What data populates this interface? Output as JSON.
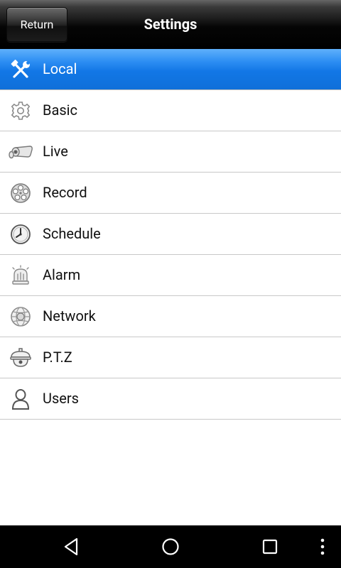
{
  "header": {
    "title": "Settings",
    "return_label": "Return"
  },
  "menu": {
    "selected_index": 0,
    "items": [
      {
        "label": "Local",
        "icon": "tools-icon"
      },
      {
        "label": "Basic",
        "icon": "gear-icon"
      },
      {
        "label": "Live",
        "icon": "camera-icon"
      },
      {
        "label": "Record",
        "icon": "film-reel-icon"
      },
      {
        "label": "Schedule",
        "icon": "clock-icon"
      },
      {
        "label": "Alarm",
        "icon": "alarm-bell-icon"
      },
      {
        "label": "Network",
        "icon": "globe-icon"
      },
      {
        "label": "P.T.Z",
        "icon": "dome-camera-icon"
      },
      {
        "label": "Users",
        "icon": "user-icon"
      }
    ]
  },
  "colors": {
    "selected_row": "#1277e6",
    "titlebar": "#000000",
    "navbar": "#000000"
  },
  "navbar": {
    "buttons": [
      "back-icon",
      "home-icon",
      "recents-icon",
      "overflow-menu-icon"
    ]
  }
}
